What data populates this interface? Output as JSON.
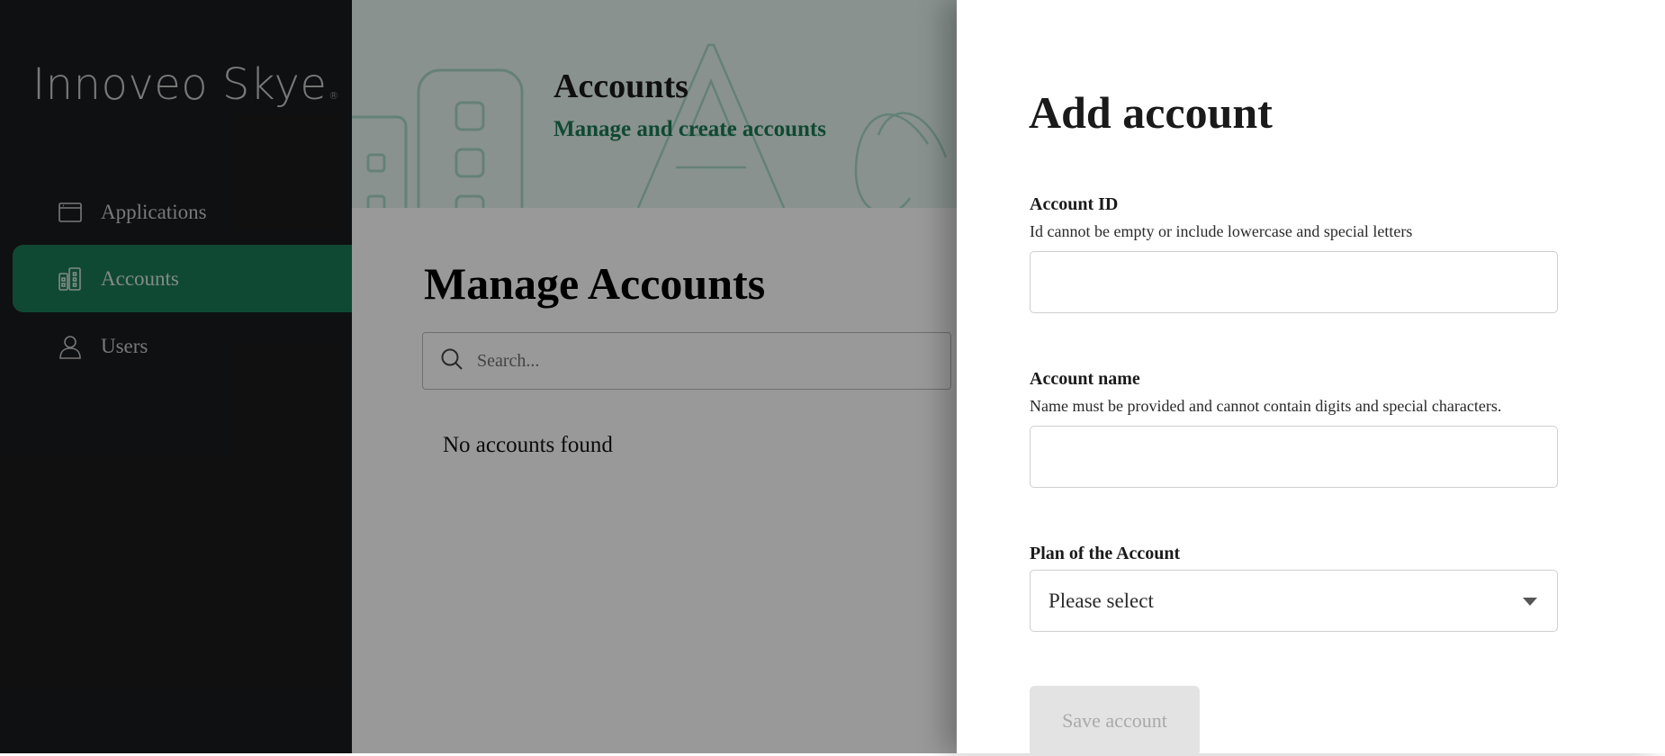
{
  "app": {
    "brand": "Innoveo Skye",
    "brand_mark": "®"
  },
  "sidebar": {
    "items": [
      {
        "label": "Applications",
        "icon": "window-icon",
        "active": false
      },
      {
        "label": "Accounts",
        "icon": "buildings-icon",
        "active": true
      },
      {
        "label": "Users",
        "icon": "user-icon",
        "active": false
      }
    ]
  },
  "hero": {
    "title": "Accounts",
    "subtitle": "Manage and create accounts"
  },
  "main": {
    "page_title": "Manage Accounts",
    "search_placeholder": "Search...",
    "empty_message": "No accounts found"
  },
  "panel": {
    "title": "Add account",
    "fields": {
      "account_id": {
        "label": "Account ID",
        "help": "Id cannot be empty or include lowercase and special letters",
        "value": ""
      },
      "account_name": {
        "label": "Account name",
        "help": "Name must be provided and cannot contain digits and special characters.",
        "value": ""
      },
      "plan": {
        "label": "Plan of the Account",
        "selected": "Please select"
      }
    },
    "save_label": "Save account",
    "save_disabled": true
  },
  "colors": {
    "sidebar_bg": "#1a1b1d",
    "accent": "#1b7a55",
    "hero_bg": "#e4f3ee"
  }
}
